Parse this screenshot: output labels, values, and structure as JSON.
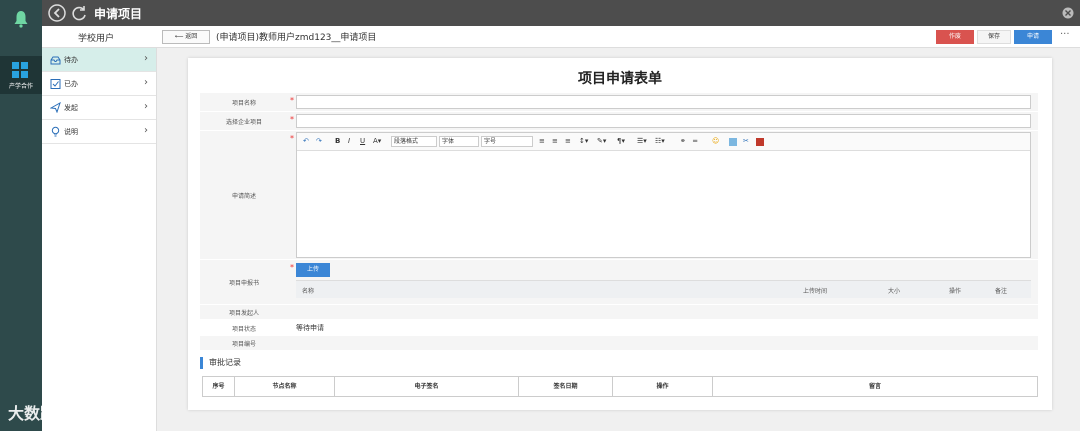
{
  "rail": {
    "app_label": "产学合作"
  },
  "titlebar": {
    "title": "申请项目"
  },
  "subheader": {
    "user_label": "学校用户",
    "return_label": "返回",
    "breadcrumb": "(申请项目)教师用户zmd123__申请项目",
    "void_label": "作废",
    "save_label": "保存",
    "apply_label": "申请",
    "more_label": "···"
  },
  "sidebar": {
    "items": [
      {
        "label": "待办",
        "icon": "inbox-icon"
      },
      {
        "label": "已办",
        "icon": "checklist-icon"
      },
      {
        "label": "发起",
        "icon": "send-icon"
      },
      {
        "label": "说明",
        "icon": "lightbulb-icon"
      }
    ]
  },
  "form": {
    "title": "项目申请表单",
    "fields": {
      "project_name": {
        "label": "项目名称",
        "value": ""
      },
      "enterprise_project": {
        "label": "选择企业项目",
        "value": ""
      },
      "description": {
        "label": "申请简述"
      },
      "report": {
        "label": "项目申报书",
        "upload_label": "上传"
      },
      "initiator": {
        "label": "项目发起人",
        "value": ""
      },
      "status": {
        "label": "项目状态",
        "value": "等待申请"
      },
      "number": {
        "label": "项目编号",
        "value": ""
      }
    },
    "editor_toolbar": {
      "paragraph_select": "段落格式",
      "font_select": "字体",
      "size_select": "字号"
    },
    "file_columns": [
      "名称",
      "上传时间",
      "大小",
      "操作",
      "备注"
    ]
  },
  "approval": {
    "title": "审批记录",
    "columns": [
      "序号",
      "节点名称",
      "电子签名",
      "签名日期",
      "操作",
      "留言"
    ]
  },
  "colors": {
    "rail": "#2e4a4b",
    "titlebar": "#4d4d4d",
    "accent": "#3b86d6",
    "danger": "#d9534f",
    "active_item": "#d6eeea"
  },
  "watermark": "大数跨境"
}
